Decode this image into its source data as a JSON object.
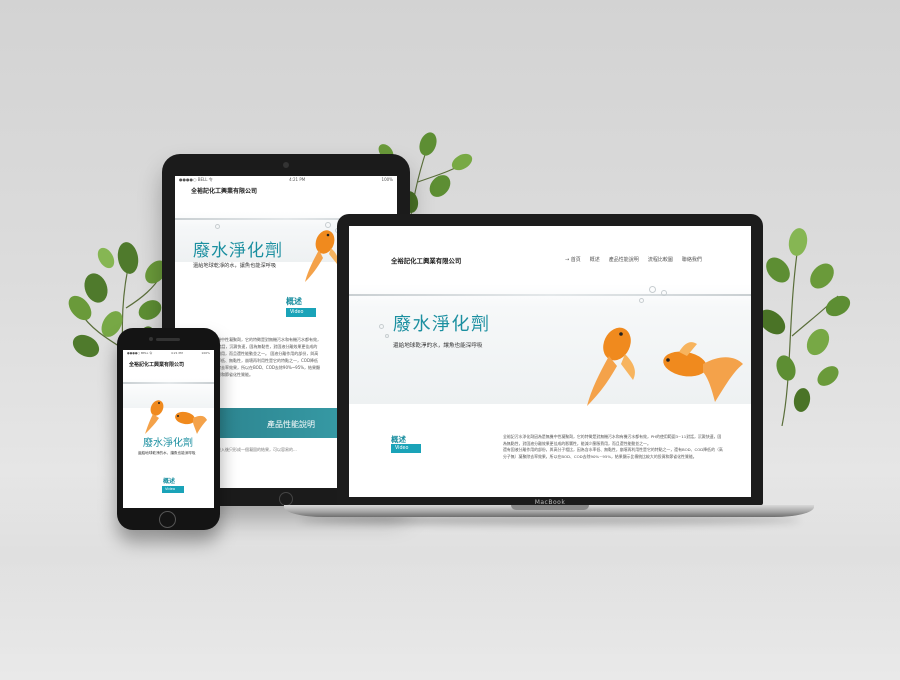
{
  "site": {
    "company": "全裕記化工興業有限公司",
    "hero_title": "廢水淨化劑",
    "hero_subtitle": "還給地球乾淨的水，讓魚也能深呼吸",
    "overview_label": "概述",
    "video_label": "Video"
  },
  "laptop": {
    "nav": [
      "→ 首頁",
      "概述",
      "產品性能說明",
      "流程比較圖",
      "聯絡我們"
    ],
    "paragraph": "全裕記污水淨化劑因為是無機中性凝聚劑，它的特徵是對無機污水和有機污水都有效，PH的使用範圍3~11對話，沉澱快速，固為無黏性，對固液分離效果更佳成的影響性，能減少膨脹費用，而且還性能動並之一。\n還有固液分離作用的部份，與高分子相比，因為含水率低、無黏性，崩壞再利用性是它的特點之一，還有BOD、COD降低的（高分子無）凝聚除去率效果，所以在BOD、COD去除90%~95%，結果顯示比傳統比較大的投資和節省化性質能。",
    "brand": "MacBook"
  },
  "tablet": {
    "status_left": "●●●●○ BELL 令",
    "status_time": "4:21 PM",
    "status_right": "100%",
    "paragraph": "污水淨化劑因為是無機中性凝聚劑，它的特徵是對無機污水和有機污水都有效，PH的使用範圍3~11對話，沉澱快速，固為無黏性，對固液分離效果更佳成的影響性，能減少膨脹費用，而且還性能動並之一。\n固液分離作用的部份，與高分子相比，固為含水率低、無黏性，崩壞再利用性是它的特點之一，COD降低的（高分子無）凝聚除去率效果，所以在BOD、COD去除90%~95%，結果顯示比傳統比較大的投資和節省化性質能。",
    "band_label": "產品性能說明",
    "bottom_text": "污水淨化劑和主藥品投入後只形成一個凝固的結果，可以容易的..."
  },
  "phone": {
    "status_left": "●●●●○ BELL 令",
    "status_time": "4:21 PM",
    "status_right": "100%"
  },
  "colors": {
    "accent": "#1b8fa0",
    "button": "#1aa3b8",
    "goldfish": "#f08a1e"
  }
}
